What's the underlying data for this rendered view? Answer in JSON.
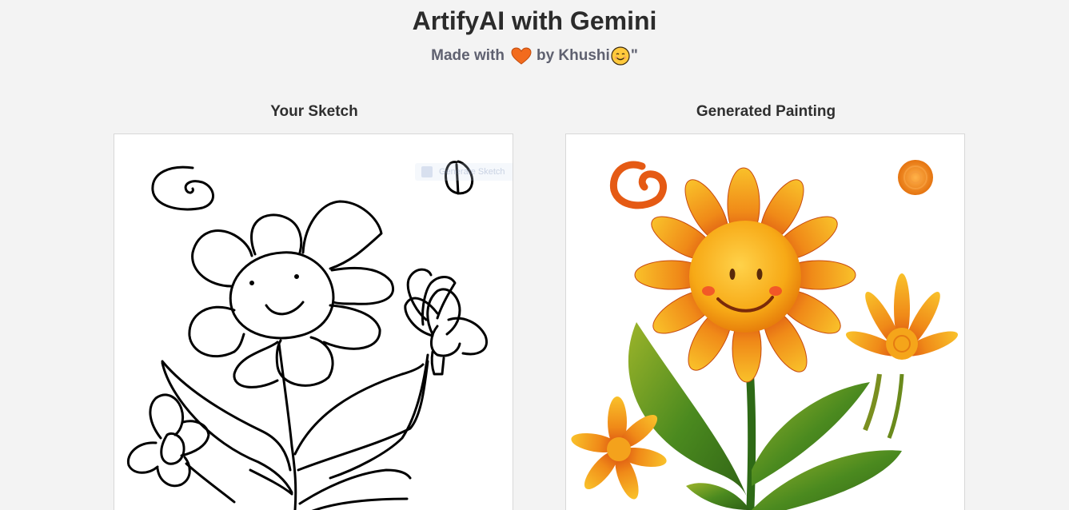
{
  "header": {
    "title": "ArtifyAI with Gemini",
    "made_with": "Made with",
    "by": "by Khushi",
    "quote": "\""
  },
  "sketch": {
    "title": "Your Sketch",
    "hidden_button_label": "Generate Sketch"
  },
  "painting": {
    "title": "Generated Painting"
  },
  "colors": {
    "background": "#f3f3f3",
    "heart": "#f26b1d",
    "petal_orange": "#f07a1a",
    "petal_yellow": "#f7b21e",
    "leaf_green": "#3f7a1d"
  },
  "icons": [
    "heart-icon",
    "smiley-icon"
  ]
}
